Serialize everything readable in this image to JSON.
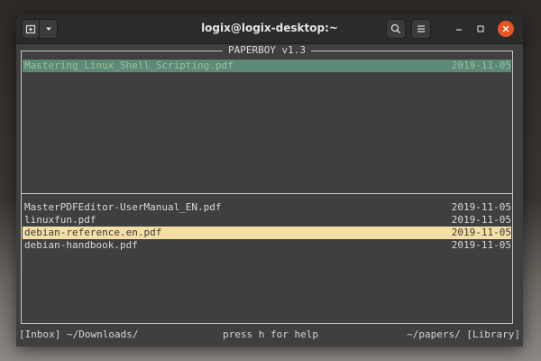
{
  "window": {
    "title": "logix@logix-desktop:~"
  },
  "icons": {
    "new_tab": "new-tab-icon",
    "dropdown": "chevron-down-icon",
    "search": "search-icon",
    "menu": "hamburger-menu-icon",
    "minimize": "minimize-icon",
    "maximize": "maximize-icon",
    "close": "close-icon"
  },
  "colors": {
    "close_button": "#e95420",
    "highlight_top": "#5b8a76",
    "highlight_bottom": "#f5dfa6",
    "terminal_bg": "#3f3f3f"
  },
  "app": {
    "title": "PAPERBOY v1.3"
  },
  "top_list": [
    {
      "name": "Mastering_Linux_Shell_Scripting.pdf",
      "date": "2019-11-05",
      "selected": true
    }
  ],
  "bottom_list": [
    {
      "name": "MasterPDFEditor-UserManual_EN.pdf",
      "date": "2019-11-05",
      "selected": false
    },
    {
      "name": "linuxfun.pdf",
      "date": "2019-11-05",
      "selected": false
    },
    {
      "name": "debian-reference.en.pdf",
      "date": "2019-11-05",
      "selected": true
    },
    {
      "name": "debian-handbook.pdf",
      "date": "2019-11-05",
      "selected": false
    }
  ],
  "status": {
    "left": "[Inbox] ~/Downloads/",
    "center": "press h for help",
    "right": "~/papers/ [Library]"
  }
}
